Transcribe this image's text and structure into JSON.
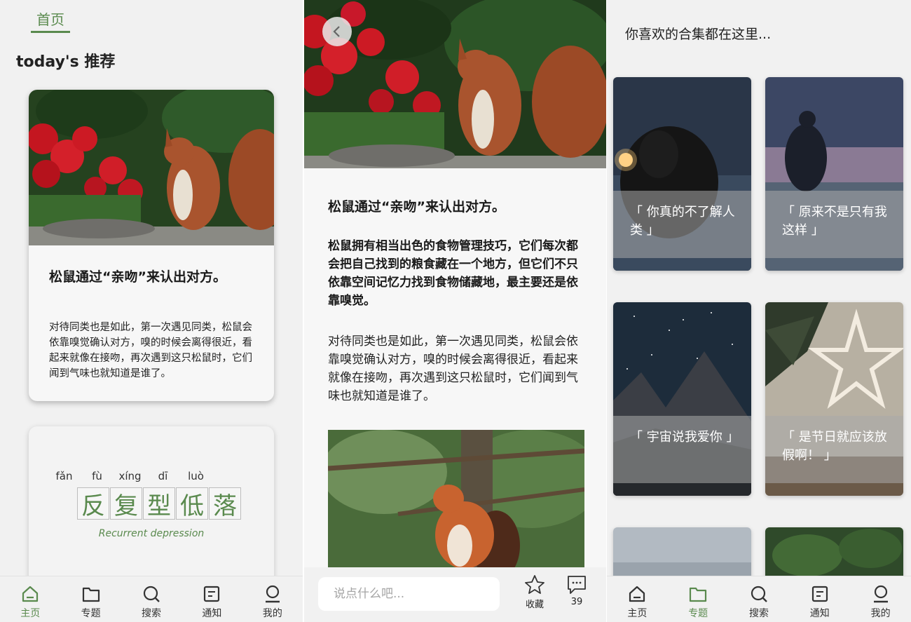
{
  "colors": {
    "accent": "#5a8a4e",
    "background": "#f1f1f1"
  },
  "home": {
    "tab_label": "首页",
    "heading": "today's 推荐",
    "card": {
      "title": "松鼠通过“亲吻”来认出对方。",
      "excerpt": "对待同类也是如此，第一次遇见同类，松鼠会依靠嗅觉确认对方，嗅的时候会离得很近，看起来就像在接吻，再次遇到这只松鼠时，它们闻到气味也就知道是谁了。"
    },
    "word_card": {
      "pinyin": [
        "fǎn",
        "fù",
        "xíng",
        "dī",
        "luò"
      ],
      "chars": [
        "反",
        "复",
        "型",
        "低",
        "落"
      ],
      "english": "Recurrent depression"
    }
  },
  "tabbar": [
    {
      "label": "主页",
      "icon": "home-icon"
    },
    {
      "label": "专题",
      "icon": "folder-icon"
    },
    {
      "label": "搜索",
      "icon": "search-icon"
    },
    {
      "label": "通知",
      "icon": "notice-icon"
    },
    {
      "label": "我的",
      "icon": "profile-icon"
    }
  ],
  "article": {
    "title": "松鼠通过“亲吻”来认出对方。",
    "bold_paragraph": "松鼠拥有相当出色的食物管理技巧，它们每次都会把自己找到的粮食藏在一个地方，但它们不只依靠空间记忆力找到食物储藏地，最主要还是依靠嗅觉。",
    "paragraph": "对待同类也是如此，第一次遇见同类，松鼠会依靠嗅觉确认对方，嗅的时候会离得很近，看起来就像在接吻，再次遇到这只松鼠时，它们闻到气味也就知道是谁了。",
    "comment_placeholder": "说点什么吧...",
    "favorite_label": "收藏",
    "comment_count": "39"
  },
  "collections": {
    "heading": "你喜欢的合集都在这里...",
    "items": [
      {
        "label": "「 你真的不了解人类 」"
      },
      {
        "label": "「 原来不是只有我这样 」"
      },
      {
        "label": "「 宇宙说我爱你 」"
      },
      {
        "label": "「 是节日就应该放假啊！ 」"
      }
    ]
  }
}
